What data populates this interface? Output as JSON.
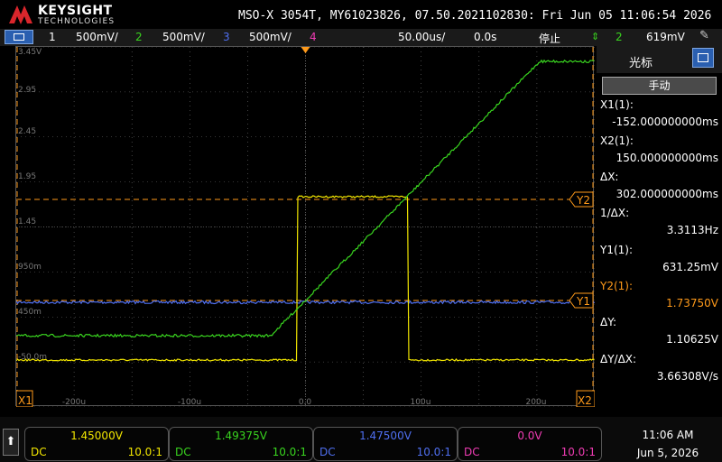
{
  "brand": {
    "name": "KEYSIGHT",
    "subtitle": "TECHNOLOGIES"
  },
  "title_bar": "MSO-X 3054T, MY61023826, 07.50.2021102830: Fri Jun 05 11:06:54 2026",
  "channel_bar": {
    "ch1_num": "1",
    "ch1_scale": "500mV/",
    "ch2_num": "2",
    "ch2_scale": "500mV/",
    "ch3_num": "3",
    "ch3_scale": "500mV/",
    "ch4_num": "4",
    "timebase": "50.00us/",
    "delay": "0.0s",
    "run_state": "停止",
    "trigger_source": "2",
    "trigger_level": "619mV"
  },
  "y_tick_labels": [
    "3.45V",
    "2.95",
    "2.45",
    "1.95",
    "1.45",
    "950m",
    "450m",
    "-50.0m"
  ],
  "x_tick_labels": [
    "-200u",
    "-100u",
    "0.0",
    "100u",
    "200u"
  ],
  "markers": {
    "x1": "X1",
    "x2": "X2",
    "y1": "Y1",
    "y2": "Y2",
    "trigger": "T",
    "ground": "1"
  },
  "cursor_panel": {
    "title": "光标",
    "mode_button": "手动",
    "x1_label": "X1(1):",
    "x1_value": "-152.000000000ms",
    "x2_label": "X2(1):",
    "x2_value": "150.000000000ms",
    "dx_label": "ΔX:",
    "dx_value": "302.000000000ms",
    "inv_dx_label": "1/ΔX:",
    "inv_dx_value": "3.3113Hz",
    "y1_label": "Y1(1):",
    "y1_value": "631.25mV",
    "y2_label": "Y2(1):",
    "y2_value": "1.73750V",
    "dy_label": "ΔY:",
    "dy_value": "1.10625V",
    "dydx_label": "ΔY/ΔX:",
    "dydx_value": "3.66308V/s"
  },
  "channel_boxes": [
    {
      "value": "1.45000V",
      "coupling": "DC",
      "probe": "10.0:1"
    },
    {
      "value": "1.49375V",
      "coupling": "DC",
      "probe": "10.0:1"
    },
    {
      "value": "1.47500V",
      "coupling": "DC",
      "probe": "10.0:1"
    },
    {
      "value": "0.0V",
      "coupling": "DC",
      "probe": "10.0:1"
    }
  ],
  "clock": {
    "time": "11:06 AM",
    "date": "Jun 5, 2026"
  },
  "colors": {
    "ch1": "#f2e600",
    "ch2": "#39d41f",
    "ch3": "#4f6ff0",
    "ch4": "#f03cb4",
    "cursor": "#ff9a1a",
    "grid": "#6e6e6e",
    "accent": "#2a5fb0"
  }
}
